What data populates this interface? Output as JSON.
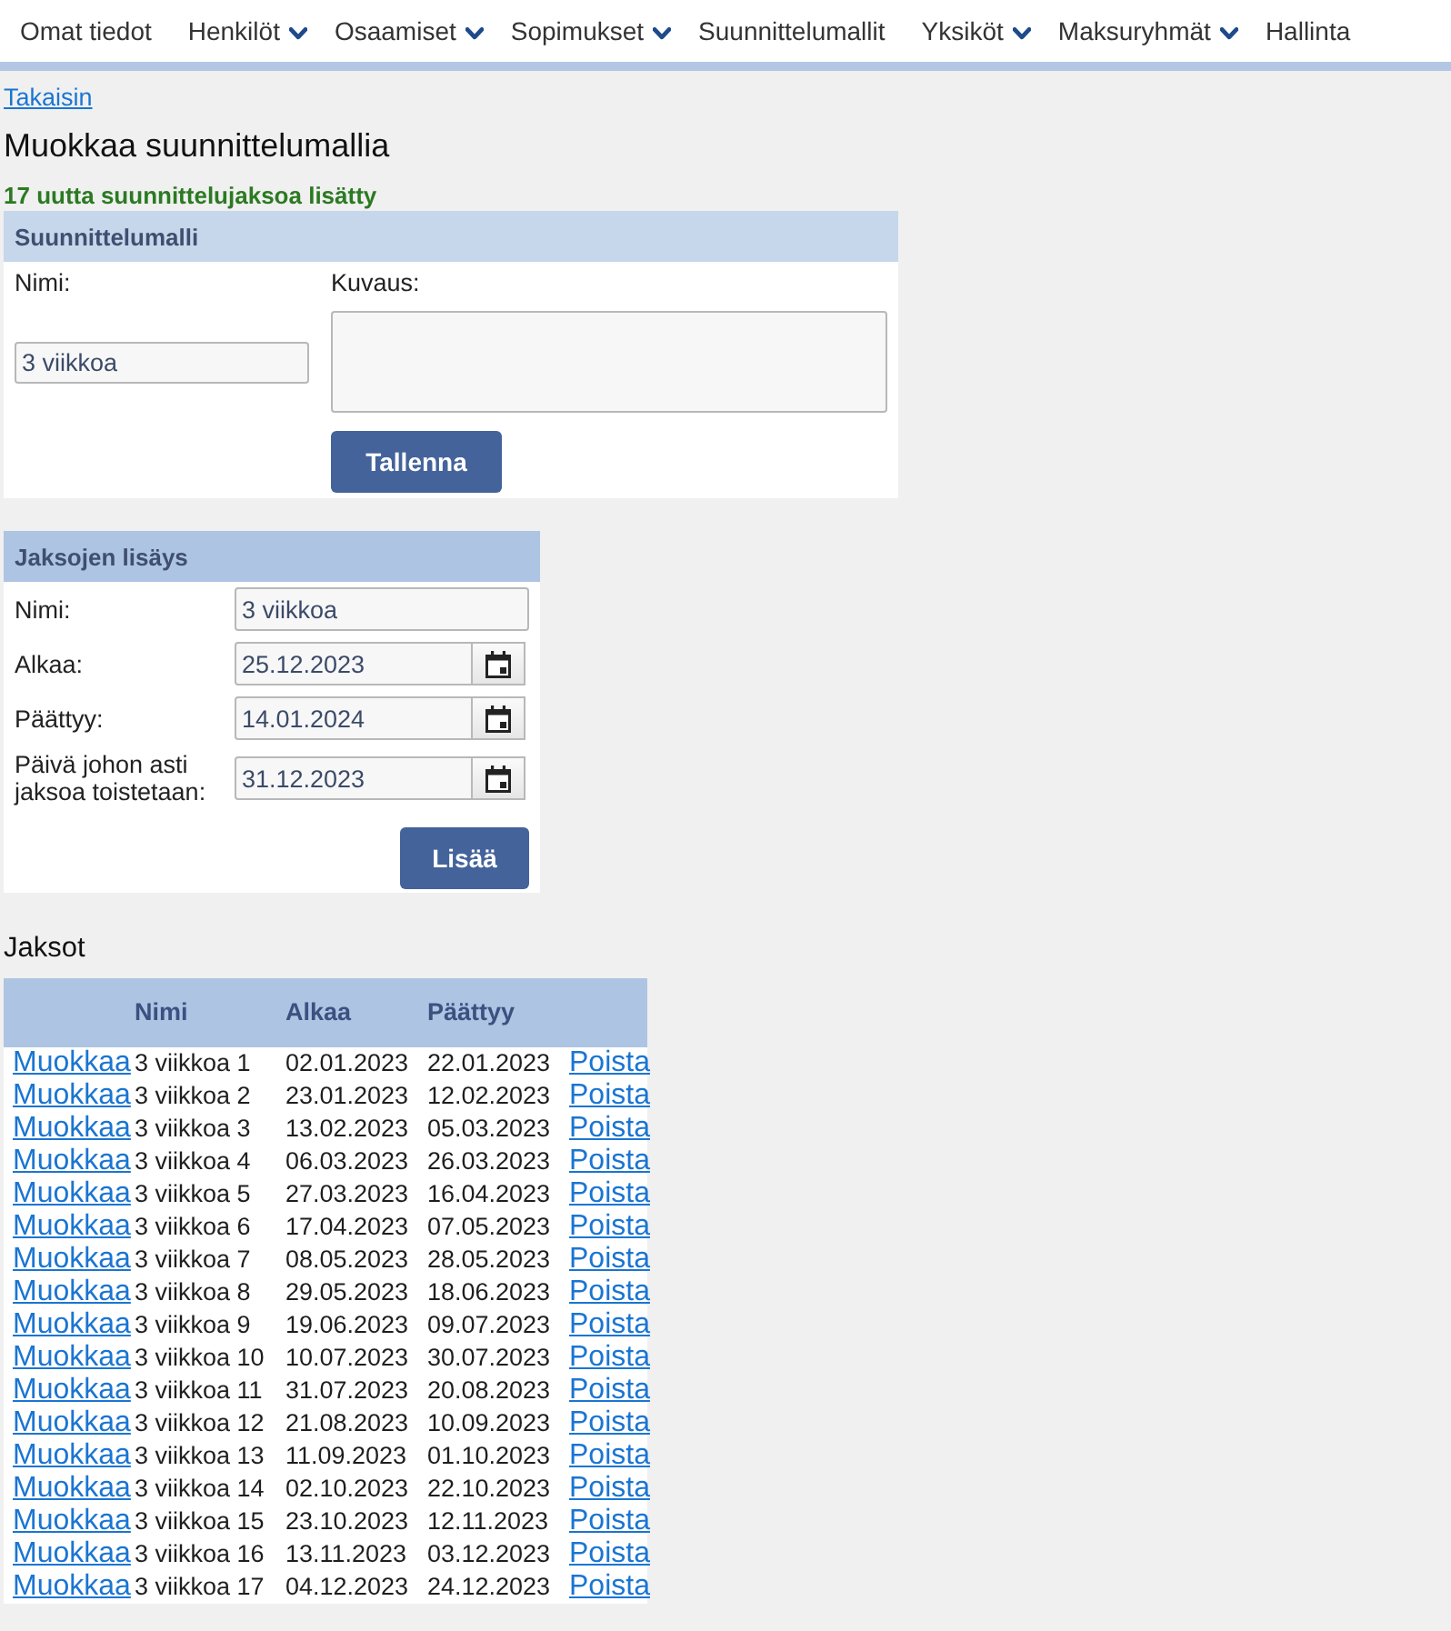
{
  "nav": {
    "items": [
      {
        "label": "Omat tiedot",
        "dropdown": false
      },
      {
        "label": "Henkilöt",
        "dropdown": true
      },
      {
        "label": "Osaamiset",
        "dropdown": true
      },
      {
        "label": "Sopimukset",
        "dropdown": true
      },
      {
        "label": "Suunnittelumallit",
        "dropdown": false
      },
      {
        "label": "Yksiköt",
        "dropdown": true
      },
      {
        "label": "Maksuryhmät",
        "dropdown": true
      },
      {
        "label": "Hallinta",
        "dropdown": false
      }
    ]
  },
  "back_link": "Takaisin",
  "title": "Muokkaa suunnittelumallia",
  "message": "17 uutta suunnittelujaksoa lisätty",
  "template_panel": {
    "title": "Suunnittelumalli",
    "name_label": "Nimi:",
    "name_value": "3 viikkoa",
    "description_label": "Kuvaus:",
    "save_button": "Tallenna"
  },
  "period_panel": {
    "title": "Jaksojen lisäys",
    "fields": [
      {
        "kind": "text",
        "label": "Nimi:",
        "value": "3 viikkoa"
      },
      {
        "kind": "date",
        "label": "Alkaa:",
        "value": "25.12.2023"
      },
      {
        "kind": "date",
        "label": "Päättyy:",
        "value": "14.01.2024"
      },
      {
        "kind": "date",
        "label": "Päivä johon asti jaksoa toistetaan:",
        "value": "31.12.2023"
      }
    ],
    "add_button": "Lisää"
  },
  "periods": {
    "title": "Jaksot",
    "columns": [
      "Nimi",
      "Alkaa",
      "Päättyy"
    ],
    "rows": [
      {
        "edit": "Muokkaa",
        "name": "3 viikkoa 1",
        "start": "02.01.2023",
        "end": "22.01.2023",
        "delete": "Poista"
      },
      {
        "edit": "Muokkaa",
        "name": "3 viikkoa 2",
        "start": "23.01.2023",
        "end": "12.02.2023",
        "delete": "Poista"
      },
      {
        "edit": "Muokkaa",
        "name": "3 viikkoa 3",
        "start": "13.02.2023",
        "end": "05.03.2023",
        "delete": "Poista"
      },
      {
        "edit": "Muokkaa",
        "name": "3 viikkoa 4",
        "start": "06.03.2023",
        "end": "26.03.2023",
        "delete": "Poista"
      },
      {
        "edit": "Muokkaa",
        "name": "3 viikkoa 5",
        "start": "27.03.2023",
        "end": "16.04.2023",
        "delete": "Poista"
      },
      {
        "edit": "Muokkaa",
        "name": "3 viikkoa 6",
        "start": "17.04.2023",
        "end": "07.05.2023",
        "delete": "Poista"
      },
      {
        "edit": "Muokkaa",
        "name": "3 viikkoa 7",
        "start": "08.05.2023",
        "end": "28.05.2023",
        "delete": "Poista"
      },
      {
        "edit": "Muokkaa",
        "name": "3 viikkoa 8",
        "start": "29.05.2023",
        "end": "18.06.2023",
        "delete": "Poista"
      },
      {
        "edit": "Muokkaa",
        "name": "3 viikkoa 9",
        "start": "19.06.2023",
        "end": "09.07.2023",
        "delete": "Poista"
      },
      {
        "edit": "Muokkaa",
        "name": "3 viikkoa 10",
        "start": "10.07.2023",
        "end": "30.07.2023",
        "delete": "Poista"
      },
      {
        "edit": "Muokkaa",
        "name": "3 viikkoa 11",
        "start": "31.07.2023",
        "end": "20.08.2023",
        "delete": "Poista"
      },
      {
        "edit": "Muokkaa",
        "name": "3 viikkoa 12",
        "start": "21.08.2023",
        "end": "10.09.2023",
        "delete": "Poista"
      },
      {
        "edit": "Muokkaa",
        "name": "3 viikkoa 13",
        "start": "11.09.2023",
        "end": "01.10.2023",
        "delete": "Poista"
      },
      {
        "edit": "Muokkaa",
        "name": "3 viikkoa 14",
        "start": "02.10.2023",
        "end": "22.10.2023",
        "delete": "Poista"
      },
      {
        "edit": "Muokkaa",
        "name": "3 viikkoa 15",
        "start": "23.10.2023",
        "end": "12.11.2023",
        "delete": "Poista"
      },
      {
        "edit": "Muokkaa",
        "name": "3 viikkoa 16",
        "start": "13.11.2023",
        "end": "03.12.2023",
        "delete": "Poista"
      },
      {
        "edit": "Muokkaa",
        "name": "3 viikkoa 17",
        "start": "04.12.2023",
        "end": "24.12.2023",
        "delete": "Poista"
      }
    ]
  }
}
